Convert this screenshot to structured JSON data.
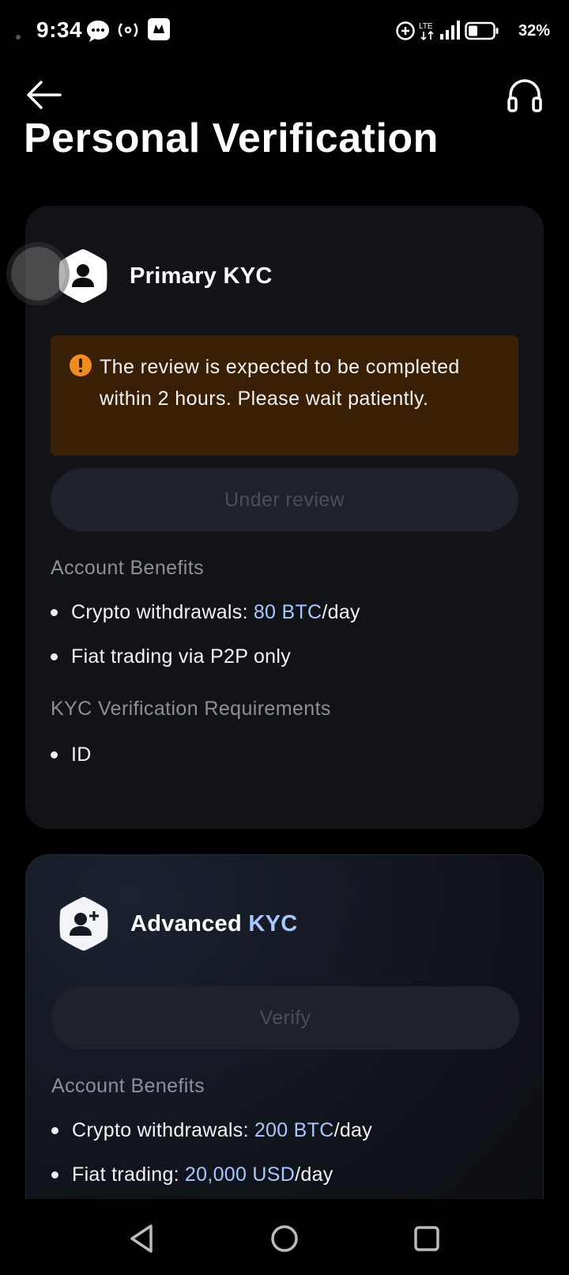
{
  "status_bar": {
    "time": "9:34",
    "battery": "32%",
    "network": "LTE"
  },
  "header": {
    "title": "Personal Verification"
  },
  "primary": {
    "name": "Primary KYC",
    "notice": "The review is expected to be completed within 2 hours. Please wait patiently.",
    "status_button": "Under review",
    "benefits_label": "Account Benefits",
    "benefit_1_prefix": "Crypto withdrawals: ",
    "benefit_1_value": "80 BTC",
    "benefit_1_suffix": "/day",
    "benefit_2": "Fiat trading via P2P only",
    "requirements_label": "KYC Verification Requirements",
    "requirement_1": "ID"
  },
  "advanced": {
    "name_prefix": "Advanced ",
    "name_accent": "KYC",
    "button": "Verify",
    "benefits_label": "Account Benefits",
    "benefit_1_prefix": "Crypto withdrawals: ",
    "benefit_1_value": "200 BTC",
    "benefit_1_suffix": "/day",
    "benefit_2_prefix": "Fiat trading: ",
    "benefit_2_value": "20,000 USD",
    "benefit_2_suffix": "/day"
  },
  "colors": {
    "background": "#000000",
    "card": "#121317",
    "accent": "#a9c7ff",
    "notice_bg": "#3a1f07",
    "notice_icon": "#f08c22"
  }
}
